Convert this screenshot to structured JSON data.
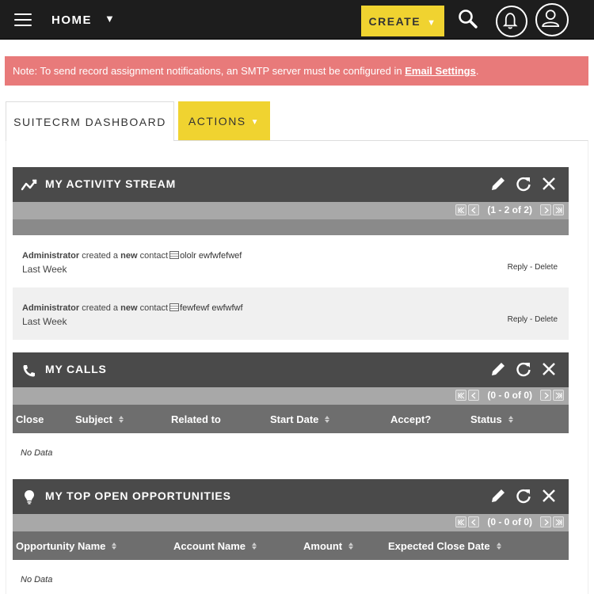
{
  "nav": {
    "home_label": "HOME",
    "create_label": "CREATE"
  },
  "alert": {
    "text": "Note: To send record assignment notifications, an SMTP server must be configured in",
    "link": "Email Settings",
    "suffix": "."
  },
  "tabs": {
    "dashboard": "SUITECRM DASHBOARD",
    "actions": "ACTIONS"
  },
  "activity": {
    "title": "MY ACTIVITY STREAM",
    "pager": "(1 - 2 of 2)",
    "items": [
      {
        "user": "Administrator",
        "verb": "created a",
        "new": "new",
        "module": "contact",
        "name": "ololr ewfwfefwef",
        "when": "Last Week",
        "reply": "Reply",
        "sep": "-",
        "delete": "Delete"
      },
      {
        "user": "Administrator",
        "verb": "created a",
        "new": "new",
        "module": "contact",
        "name": "fewfewf ewfwfwf",
        "when": "Last Week",
        "reply": "Reply",
        "sep": "-",
        "delete": "Delete"
      }
    ]
  },
  "calls": {
    "title": "MY CALLS",
    "pager": "(0 - 0 of 0)",
    "columns": [
      "Close",
      "Subject",
      "Related to",
      "Start Date",
      "Accept?",
      "Status"
    ],
    "no_data": "No Data"
  },
  "opportunities": {
    "title": "MY TOP OPEN OPPORTUNITIES",
    "pager": "(0 - 0 of 0)",
    "columns": [
      "Opportunity Name",
      "Account Name",
      "Amount",
      "Expected Close Date"
    ],
    "no_data": "No Data"
  },
  "colors": {
    "accent": "#f0d330",
    "navbar": "#1d1d1d",
    "alert": "#e87a7a",
    "dashlet_header": "#4a4a4a"
  }
}
